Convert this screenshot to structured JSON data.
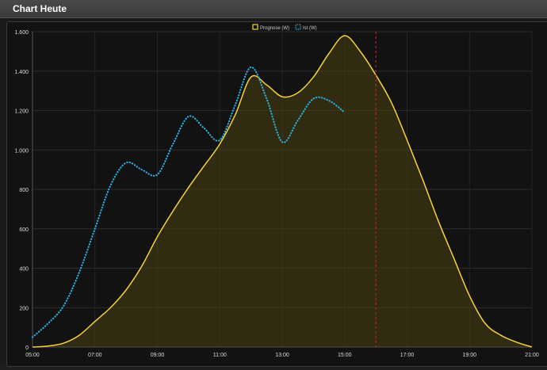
{
  "panel": {
    "title": "Chart Heute"
  },
  "chart_data": {
    "type": "area",
    "title": "",
    "xlabel": "",
    "ylabel": "",
    "ylim": [
      0,
      1600
    ],
    "y_ticks": [
      "0",
      "200",
      "400",
      "600",
      "800",
      "1.000",
      "1.200",
      "1.400",
      "1.600"
    ],
    "y_tick_values": [
      0,
      200,
      400,
      600,
      800,
      1000,
      1200,
      1400,
      1600
    ],
    "x_ticks": [
      "05:00",
      "07:00",
      "09:00",
      "11:00",
      "13:00",
      "15:00",
      "17:00",
      "19:00",
      "21:00"
    ],
    "x_tick_hours": [
      5,
      7,
      9,
      11,
      13,
      15,
      17,
      19,
      21
    ],
    "xlim_hours": [
      5,
      21
    ],
    "grid": true,
    "legend_position": "top-center",
    "now_marker_hour": 16,
    "series": [
      {
        "name": "Prognose (W)",
        "style": "solid-area",
        "color": "#f5d33a",
        "x_hours": [
          5,
          5.5,
          6,
          6.5,
          7,
          7.5,
          8,
          8.5,
          9,
          9.5,
          10,
          10.5,
          11,
          11.5,
          12,
          12.5,
          13,
          13.5,
          14,
          14.5,
          15,
          15.5,
          16,
          16.5,
          17,
          17.5,
          18,
          18.5,
          19,
          19.5,
          20,
          20.5,
          21
        ],
        "values": [
          0,
          5,
          20,
          60,
          130,
          200,
          290,
          410,
          560,
          690,
          810,
          920,
          1030,
          1180,
          1370,
          1330,
          1270,
          1290,
          1370,
          1490,
          1580,
          1500,
          1380,
          1240,
          1050,
          850,
          640,
          450,
          260,
          120,
          60,
          25,
          0
        ]
      },
      {
        "name": "Ist (W)",
        "style": "dotted",
        "color": "#29b6e8",
        "x_hours": [
          5,
          5.5,
          6,
          6.5,
          7,
          7.5,
          8,
          8.5,
          9,
          9.5,
          10,
          10.5,
          11,
          11.5,
          12,
          12.5,
          13,
          13.5,
          14,
          14.5,
          15
        ],
        "values": [
          50,
          120,
          210,
          380,
          600,
          820,
          935,
          900,
          875,
          1030,
          1170,
          1110,
          1050,
          1230,
          1420,
          1260,
          1040,
          1150,
          1260,
          1250,
          1190
        ]
      }
    ]
  }
}
